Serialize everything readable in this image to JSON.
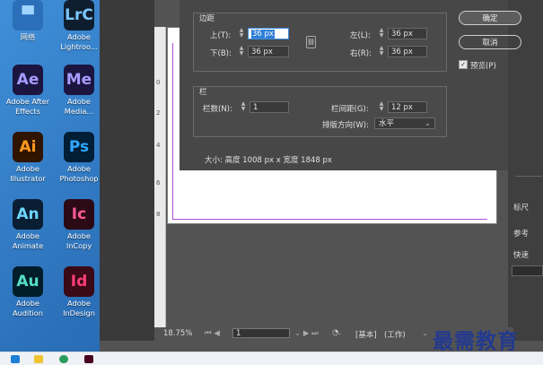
{
  "desktop": {
    "icons": [
      {
        "label": "网络",
        "tile": "▀",
        "color": "#2a6fb8",
        "fg": "#9fd4ff"
      },
      {
        "label": "Adobe Lightroo...",
        "tile": "LrC",
        "color": "#0f1e2e",
        "fg": "#7cc7ff"
      },
      {
        "label": "Adobe After Effects",
        "tile": "Ae",
        "color": "#1b1540",
        "fg": "#a79cff"
      },
      {
        "label": "Adobe Media...",
        "tile": "Me",
        "color": "#1b1540",
        "fg": "#a79cff"
      },
      {
        "label": "Adobe Illustrator",
        "tile": "Ai",
        "color": "#2f1400",
        "fg": "#ff9a1e"
      },
      {
        "label": "Adobe Photoshop",
        "tile": "Ps",
        "color": "#001e36",
        "fg": "#31a8ff"
      },
      {
        "label": "Adobe Animate",
        "tile": "An",
        "color": "#0a1e33",
        "fg": "#6dd4ff"
      },
      {
        "label": "Adobe InCopy",
        "tile": "Ic",
        "color": "#2b0a16",
        "fg": "#ff5a95"
      },
      {
        "label": "Adobe Audition",
        "tile": "Au",
        "color": "#001d2b",
        "fg": "#55e0c4"
      },
      {
        "label": "Adobe InDesign",
        "tile": "Id",
        "color": "#3a0a16",
        "fg": "#ff3d7a"
      }
    ]
  },
  "dialog": {
    "margins_title": "边距",
    "top_label": "上(T):",
    "top_value": "36 px",
    "bottom_label": "下(B):",
    "bottom_value": "36 px",
    "left_label": "左(L):",
    "left_value": "36 px",
    "right_label": "右(R):",
    "right_value": "36 px",
    "columns_title": "栏",
    "columns_label": "栏数(N):",
    "columns_value": "1",
    "gutter_label": "栏间距(G):",
    "gutter_value": "12 px",
    "direction_label": "排版方向(W):",
    "direction_value": "水平",
    "size_text": "大小: 高度 1008 px x 宽度 1848 px",
    "ok_label": "确定",
    "cancel_label": "取消",
    "preview_label": "预览(P)"
  },
  "statusbar": {
    "zoom": "18.75%",
    "page": "1",
    "style": "[基本]",
    "workspace": "(工作)"
  },
  "right_panel": {
    "items": [
      "标尺",
      "参考",
      "快速"
    ]
  },
  "watermark": "最需教育"
}
